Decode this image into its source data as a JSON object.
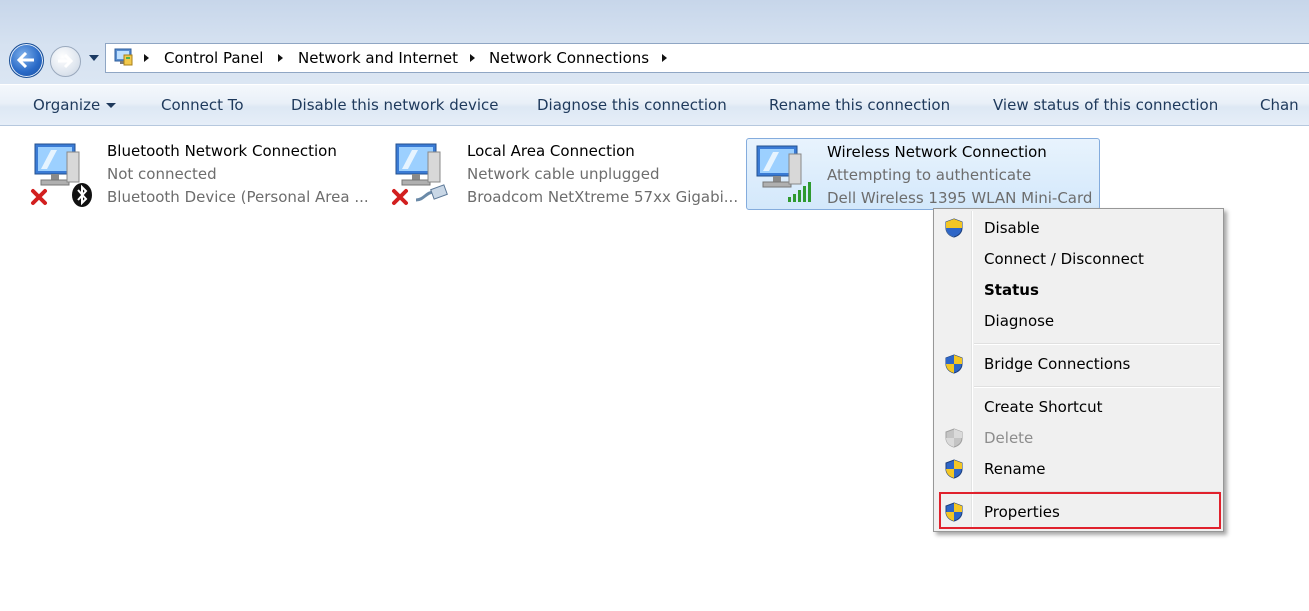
{
  "address_bar": {
    "breadcrumbs": [
      "Control Panel",
      "Network and Internet",
      "Network Connections"
    ]
  },
  "toolbar": {
    "organize": "Organize",
    "connect_to": "Connect To",
    "disable": "Disable this network device",
    "diagnose": "Diagnose this connection",
    "rename": "Rename this connection",
    "view_status": "View status of this connection",
    "change": "Chan"
  },
  "connections": [
    {
      "name": "Bluetooth Network Connection",
      "status": "Not connected",
      "device": "Bluetooth Device (Personal Area ...",
      "icon": "network-computer-icon",
      "badge": "bluetooth-icon",
      "error": true
    },
    {
      "name": "Local Area Connection",
      "status": "Network cable unplugged",
      "device": "Broadcom NetXtreme 57xx Gigabi...",
      "icon": "network-computer-icon",
      "badge": "ethernet-cable-icon",
      "error": true
    },
    {
      "name": "Wireless Network Connection",
      "status": "Attempting to authenticate",
      "device": "Dell Wireless 1395 WLAN Mini-Card",
      "icon": "network-computer-icon",
      "badge": "signal-bars-icon",
      "error": false,
      "selected": true
    }
  ],
  "context_menu": {
    "items": [
      {
        "label": "Disable",
        "shield": true
      },
      {
        "label": "Connect / Disconnect",
        "shield": false
      },
      {
        "label": "Status",
        "shield": false,
        "bold": true
      },
      {
        "label": "Diagnose",
        "shield": false
      },
      {
        "label": "Bridge Connections",
        "shield": true
      },
      {
        "label": "Create Shortcut",
        "shield": false
      },
      {
        "label": "Delete",
        "shield": true,
        "disabled": true
      },
      {
        "label": "Rename",
        "shield": true
      },
      {
        "label": "Properties",
        "shield": true,
        "highlighted": true
      }
    ]
  },
  "colors": {
    "highlight_box": "#e0212c",
    "selection_border": "#84acdd",
    "link_text": "#1e395b"
  }
}
